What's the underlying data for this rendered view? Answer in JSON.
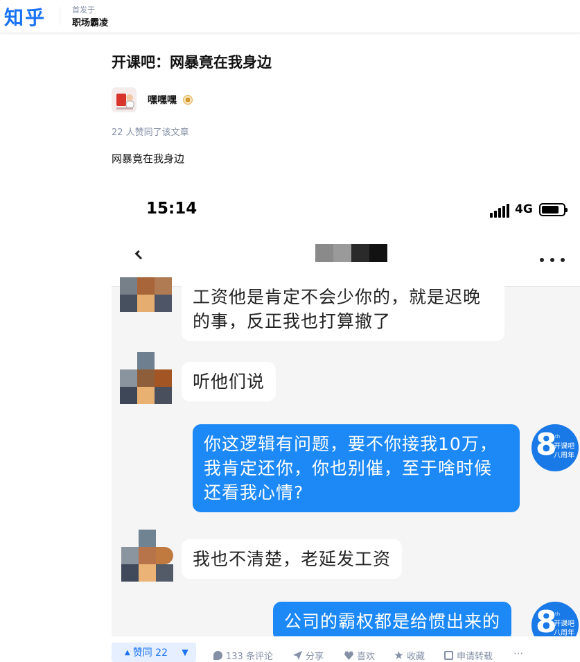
{
  "header": {
    "logo": "知乎",
    "published_label": "首发于",
    "column_name": "职场霸凌"
  },
  "article": {
    "title": "开课吧：网暴竟在我身边",
    "author": "嘿嘿嘿",
    "likes_text": "22 人赞同了该文章",
    "body": "网暴竟在我身边"
  },
  "screenshot": {
    "time": "15:14",
    "network": "4G",
    "messages": [
      {
        "side": "left",
        "text": "工资他是肯定不会少你的，就是迟晚的事，反正我也打算撤了"
      },
      {
        "side": "left",
        "text": "听他们说"
      },
      {
        "side": "right",
        "text": "你这逻辑有问题，要不你接我10万，我肯定还你，你也别催，至于啥时候还看我心情?"
      },
      {
        "side": "left",
        "text": "我也不清楚，老延发工资"
      },
      {
        "side": "right",
        "text": "公司的霸权都是给惯出来的"
      }
    ],
    "my_avatar": {
      "digit": "8",
      "small": "th",
      "line1": "开课吧",
      "line2": "八周年"
    }
  },
  "actions": {
    "upvote": "赞同 22",
    "comments": "133 条评论",
    "share": "分享",
    "like": "喜欢",
    "favorite": "收藏",
    "repost": "申请转载",
    "more": "···"
  },
  "colors": {
    "brand": "#1772f6",
    "bubble_right": "#1d89f7",
    "chat_bg": "#f5f5f5"
  }
}
